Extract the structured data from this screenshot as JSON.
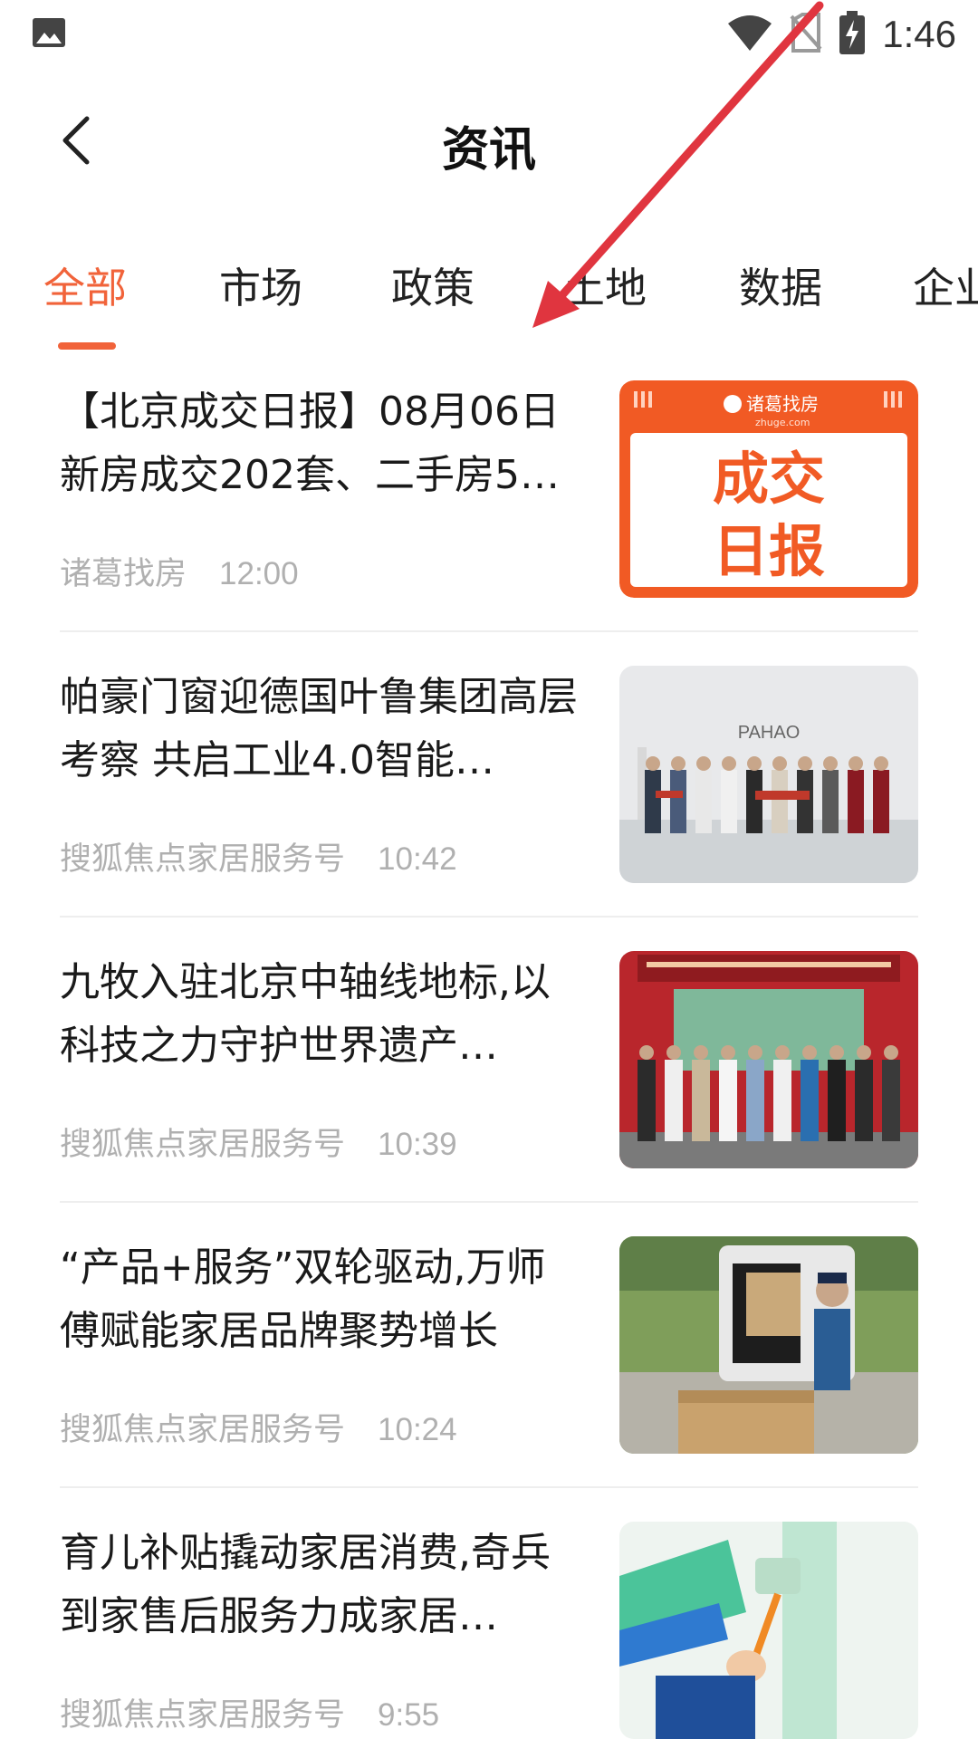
{
  "status_bar": {
    "time": "1:46"
  },
  "header": {
    "title": "资讯"
  },
  "tabs": [
    {
      "label": "全部"
    },
    {
      "label": "市场"
    },
    {
      "label": "政策"
    },
    {
      "label": "土地"
    },
    {
      "label": "数据"
    },
    {
      "label": "企业"
    }
  ],
  "news": [
    {
      "title": "【北京成交日报】08月06日新房成交202套、二手房5…",
      "source": "诸葛找房",
      "time": "12:00",
      "thumb_brand": "诸葛找房",
      "thumb_brand_sub": "zhuge.com",
      "thumb_line1": "成交",
      "thumb_line2": "日报"
    },
    {
      "title": "帕豪门窗迎德国叶鲁集团高层考察 共启工业4.0智能…",
      "source": "搜狐焦点家居服务号",
      "time": "10:42",
      "thumb_text": "PAHAO"
    },
    {
      "title": "九牧入驻北京中轴线地标,以科技之力守护世界遗产…",
      "source": "搜狐焦点家居服务号",
      "time": "10:39"
    },
    {
      "title": "“产品+服务”双轮驱动,万师傅赋能家居品牌聚势增长",
      "source": "搜狐焦点家居服务号",
      "time": "10:24"
    },
    {
      "title": "育儿补贴撬动家居消费,奇兵到家售后服务力成家居…",
      "source": "搜狐焦点家居服务号",
      "time": "9:55"
    }
  ],
  "colors": {
    "accent": "#f1633a",
    "annotation_arrow": "#e0353f"
  }
}
